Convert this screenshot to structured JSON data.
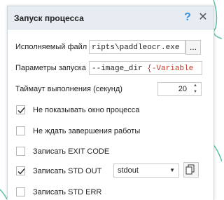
{
  "dialog": {
    "title": "Запуск процесса",
    "help_icon": "?",
    "close_icon": "✕"
  },
  "executable": {
    "label": "Исполняемый файл",
    "value_prefix": "ripts\\",
    "value_main": "paddleocr.exe",
    "browse_label": "..."
  },
  "params": {
    "label": "Параметры запуска",
    "value_text": "--image_dir ",
    "value_var": "{-Variable"
  },
  "timeout": {
    "label": "Таймаут выполнения (секунд)",
    "value": "20"
  },
  "options": [
    {
      "label": "Не показывать окно процесса",
      "checked": true
    },
    {
      "label": "Не ждать завершения работы",
      "checked": false
    },
    {
      "label": "Записать EXIT CODE",
      "checked": false
    },
    {
      "label": "Записать STD OUT",
      "checked": true
    },
    {
      "label": "Записать STD ERR",
      "checked": false
    }
  ],
  "stdout_select": {
    "value": "stdout"
  },
  "colors": {
    "accent": "#3d8fd8",
    "variable": "#c0392b",
    "curve": "#5fc0a8"
  }
}
